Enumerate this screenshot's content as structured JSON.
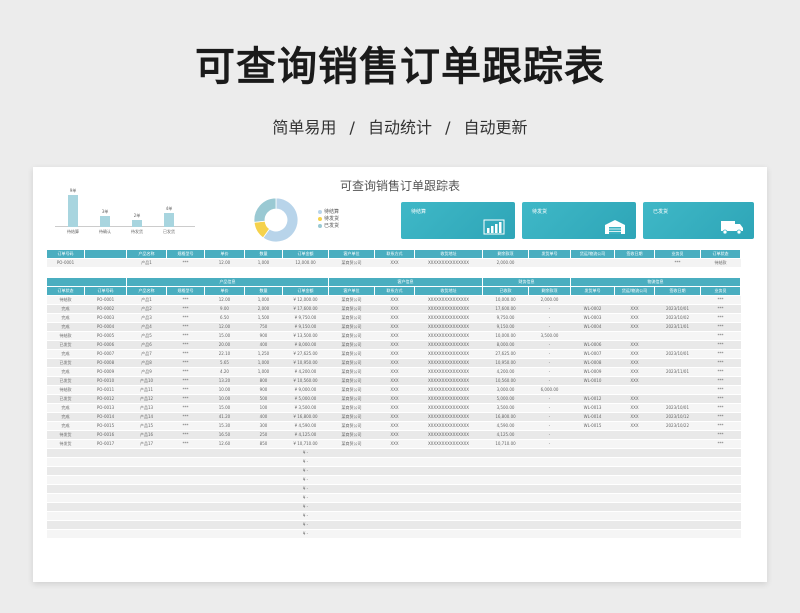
{
  "page": {
    "title": "可查询销售订单跟踪表",
    "subtitle": "简单易用 / 自动统计 / 自动更新"
  },
  "sheet": {
    "title": "可查询销售订单跟踪表"
  },
  "bar_chart": {
    "items": [
      {
        "label": "待结算",
        "value": "9单",
        "level": 9
      },
      {
        "label": "待确认",
        "value": "3单",
        "level": 3
      },
      {
        "label": "待发货",
        "value": "2单",
        "level": 2
      },
      {
        "label": "已发货",
        "value": "4单",
        "level": 4
      }
    ],
    "color": "#a8d5df"
  },
  "donut": {
    "slices": [
      {
        "name": "待结算",
        "value": 9,
        "color": "#b8d4ea"
      },
      {
        "name": "待发货",
        "value": 2,
        "color": "#f5d24c"
      },
      {
        "name": "已发货",
        "value": 4,
        "color": "#9ac9d3"
      }
    ]
  },
  "cards": [
    {
      "label": "待结算",
      "icon": "bar-chart-icon"
    },
    {
      "label": "待发货",
      "icon": "warehouse-icon"
    },
    {
      "label": "已发货",
      "icon": "truck-icon"
    }
  ],
  "search": {
    "headers": [
      "订单号码",
      "",
      "产品名称",
      "规格型号",
      "单价",
      "数量",
      "订单金额",
      "客户单位",
      "联系方式",
      "收货地址",
      "剩余款项",
      "发货单号",
      "货运/物流公司",
      "签收日期",
      "业务员",
      "订单状态"
    ],
    "row": [
      "PO-0001",
      "",
      "产品1",
      "***",
      "12.00",
      "1,000",
      "12,000.00",
      "某商贸公司",
      "XXX",
      "XXXXXXXXXXXXXXX",
      "2,000.00",
      "",
      "",
      "",
      "***",
      "待结款"
    ]
  },
  "table": {
    "groups": [
      {
        "label": "",
        "span": 2
      },
      {
        "label": "产品信息",
        "span": 5
      },
      {
        "label": "客户信息",
        "span": 3
      },
      {
        "label": "财务信息",
        "span": 2
      },
      {
        "label": "物流信息",
        "span": 4
      },
      {
        "label": "",
        "span": 1
      }
    ],
    "headers": [
      "订单状态",
      "订单号码",
      "产品名称",
      "规格型号",
      "单价",
      "数量",
      "订单金额",
      "客户单位",
      "联系方式",
      "收货地址",
      "已收款",
      "剩余款项",
      "发货单号",
      "货运/物流公司",
      "签收日期",
      "业务员"
    ],
    "rows": [
      [
        "待结款",
        "PO-0001",
        "产品1",
        "***",
        "12.00",
        "1,000",
        "¥ 12,000.00",
        "某商贸公司",
        "XXX",
        "XXXXXXXXXXXXXXX",
        "10,000.00",
        "2,000.00",
        "",
        "",
        "",
        "***"
      ],
      [
        "完成",
        "PO-0002",
        "产品2",
        "***",
        "9.00",
        "2,000",
        "¥ 17,600.00",
        "某商贸公司",
        "XXX",
        "XXXXXXXXXXXXXXX",
        "17,600.00",
        "-",
        "WL-0002",
        "XXX",
        "2023/10/01",
        "***"
      ],
      [
        "完成",
        "PO-0003",
        "产品3",
        "***",
        "6.50",
        "1,500",
        "¥ 9,750.00",
        "某商贸公司",
        "XXX",
        "XXXXXXXXXXXXXXX",
        "9,750.00",
        "-",
        "WL-0003",
        "XXX",
        "2023/10/02",
        "***"
      ],
      [
        "完成",
        "PO-0004",
        "产品4",
        "***",
        "12.00",
        "750",
        "¥ 9,150.00",
        "某商贸公司",
        "XXX",
        "XXXXXXXXXXXXXXX",
        "9,150.00",
        "-",
        "WL-0004",
        "XXX",
        "2023/11/01",
        "***"
      ],
      [
        "待结款",
        "PO-0005",
        "产品5",
        "***",
        "15.00",
        "900",
        "¥ 13,500.00",
        "某商贸公司",
        "XXX",
        "XXXXXXXXXXXXXXX",
        "10,000.00",
        "3,500.00",
        "",
        "",
        "",
        "***"
      ],
      [
        "已发货",
        "PO-0006",
        "产品6",
        "***",
        "20.00",
        "400",
        "¥ 8,000.00",
        "某商贸公司",
        "XXX",
        "XXXXXXXXXXXXXXX",
        "8,000.00",
        "-",
        "WL-0006",
        "XXX",
        "",
        "***"
      ],
      [
        "完成",
        "PO-0007",
        "产品7",
        "***",
        "22.10",
        "1,250",
        "¥ 27,625.00",
        "某商贸公司",
        "XXX",
        "XXXXXXXXXXXXXXX",
        "27,625.00",
        "-",
        "WL-0007",
        "XXX",
        "2023/10/01",
        "***"
      ],
      [
        "已发货",
        "PO-0008",
        "产品8",
        "***",
        "5.65",
        "1,000",
        "¥ 10,950.00",
        "某商贸公司",
        "XXX",
        "XXXXXXXXXXXXXXX",
        "10,950.00",
        "-",
        "WL-0008",
        "XXX",
        "",
        "***"
      ],
      [
        "完成",
        "PO-0009",
        "产品9",
        "***",
        "4.20",
        "1,000",
        "¥ 4,200.00",
        "某商贸公司",
        "XXX",
        "XXXXXXXXXXXXXXX",
        "4,200.00",
        "-",
        "WL-0009",
        "XXX",
        "2023/11/01",
        "***"
      ],
      [
        "已发货",
        "PO-0010",
        "产品10",
        "***",
        "13.20",
        "800",
        "¥ 10,560.00",
        "某商贸公司",
        "XXX",
        "XXXXXXXXXXXXXXX",
        "10,560.00",
        "-",
        "WL-0010",
        "XXX",
        "",
        "***"
      ],
      [
        "待结款",
        "PO-0011",
        "产品11",
        "***",
        "10.00",
        "900",
        "¥ 9,000.00",
        "某商贸公司",
        "XXX",
        "XXXXXXXXXXXXXXX",
        "3,000.00",
        "6,000.00",
        "",
        "",
        "",
        "***"
      ],
      [
        "已发货",
        "PO-0012",
        "产品12",
        "***",
        "10.00",
        "500",
        "¥ 5,000.00",
        "某商贸公司",
        "XXX",
        "XXXXXXXXXXXXXXX",
        "5,000.00",
        "-",
        "WL-0012",
        "XXX",
        "",
        "***"
      ],
      [
        "完成",
        "PO-0013",
        "产品13",
        "***",
        "15.00",
        "100",
        "¥ 3,500.00",
        "某商贸公司",
        "XXX",
        "XXXXXXXXXXXXXXX",
        "3,500.00",
        "-",
        "WL-0013",
        "XXX",
        "2023/10/01",
        "***"
      ],
      [
        "完成",
        "PO-0014",
        "产品14",
        "***",
        "41.20",
        "400",
        "¥ 16,800.00",
        "某商贸公司",
        "XXX",
        "XXXXXXXXXXXXXXX",
        "16,800.00",
        "-",
        "WL-0014",
        "XXX",
        "2023/10/12",
        "***"
      ],
      [
        "完成",
        "PO-0015",
        "产品15",
        "***",
        "15.30",
        "300",
        "¥ 4,590.00",
        "某商贸公司",
        "XXX",
        "XXXXXXXXXXXXXXX",
        "4,590.00",
        "-",
        "WL-0015",
        "XXX",
        "2023/10/22",
        "***"
      ],
      [
        "待发货",
        "PO-0016",
        "产品16",
        "***",
        "16.50",
        "250",
        "¥ 4,125.00",
        "某商贸公司",
        "XXX",
        "XXXXXXXXXXXXXXX",
        "4,125.00",
        "-",
        "",
        "",
        "",
        "***"
      ],
      [
        "待发货",
        "PO-0017",
        "产品17",
        "***",
        "12.60",
        "850",
        "¥ 10,710.00",
        "某商贸公司",
        "XXX",
        "XXXXXXXXXXXXXXX",
        "10,710.00",
        "-",
        "",
        "",
        "",
        "***"
      ]
    ],
    "empty_row": [
      "",
      "",
      "",
      "",
      "",
      "",
      "¥ -",
      "",
      "",
      "",
      "",
      "",
      "",
      "",
      "",
      ""
    ],
    "empty_count": 10
  }
}
